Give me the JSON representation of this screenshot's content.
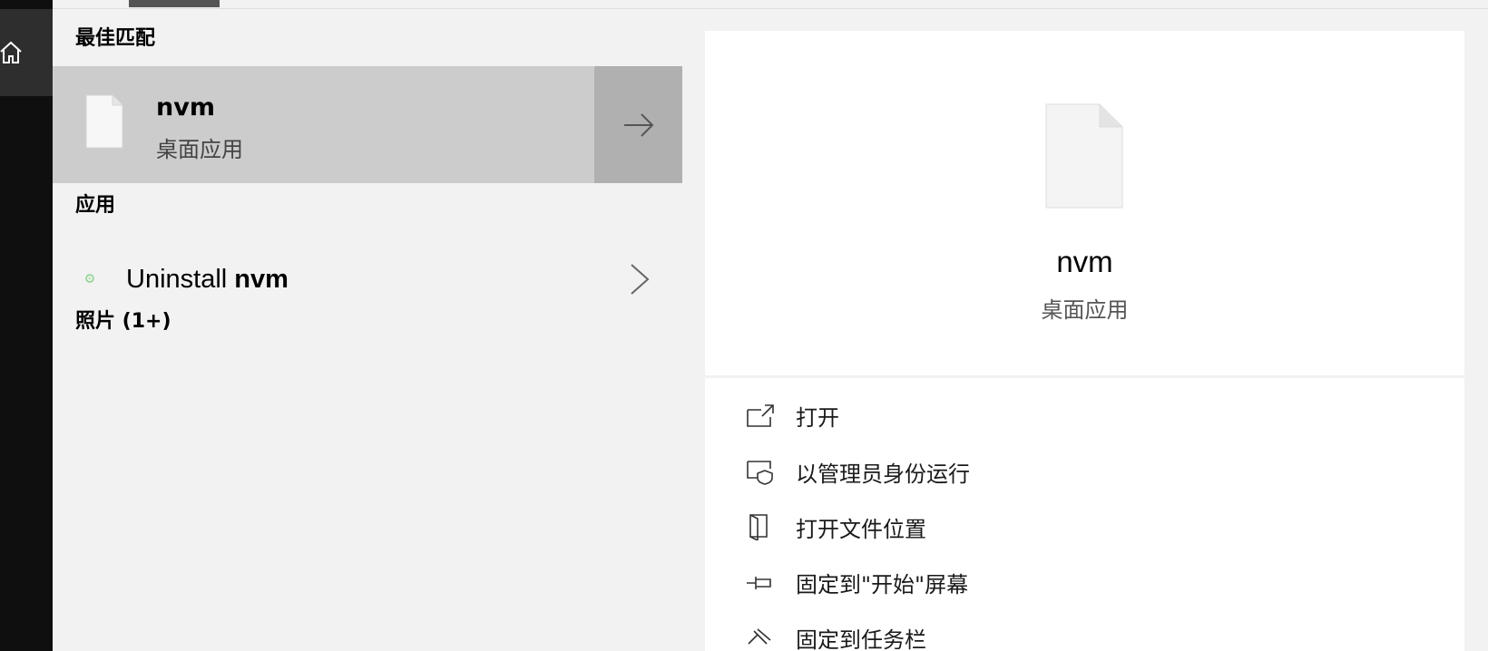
{
  "results": {
    "best_match_heading": "最佳匹配",
    "best_match": {
      "name": "nvm",
      "type": "桌面应用"
    },
    "apps_heading": "应用",
    "apps": [
      {
        "prefix": "Uninstall ",
        "match": "nvm"
      }
    ],
    "photos_heading": "照片 (1+)"
  },
  "details": {
    "name": "nvm",
    "type": "桌面应用",
    "actions": [
      {
        "label": "打开",
        "icon": "open-icon"
      },
      {
        "label": "以管理员身份运行",
        "icon": "run-as-admin-icon"
      },
      {
        "label": "打开文件位置",
        "icon": "file-location-icon"
      },
      {
        "label": "固定到\"开始\"屏幕",
        "icon": "pin-start-icon"
      },
      {
        "label": "固定到任务栏",
        "icon": "pin-taskbar-icon"
      }
    ]
  },
  "colors": {
    "selected_row": "#cccccc",
    "arrow_bg": "#b0b0b0",
    "rail": "#0f0f0f"
  }
}
